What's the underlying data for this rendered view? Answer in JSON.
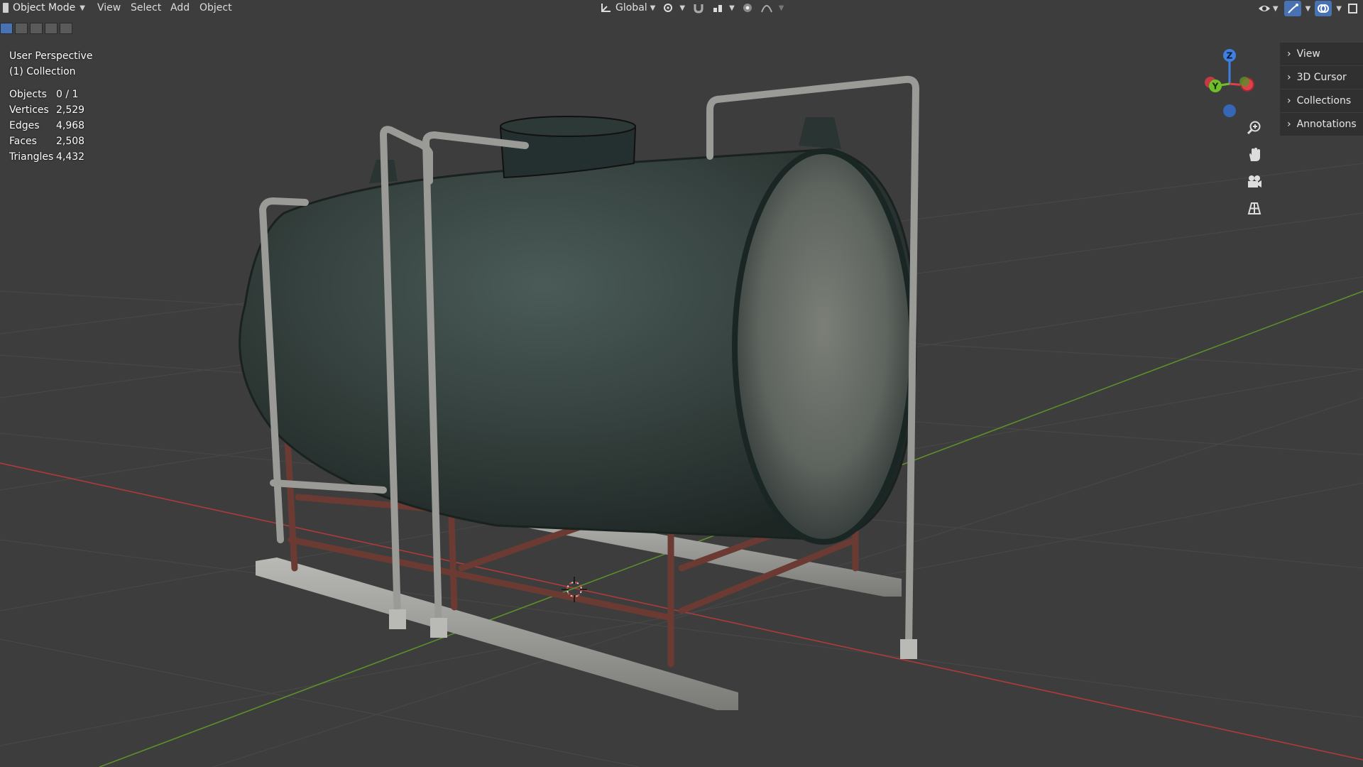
{
  "header": {
    "mode": "Object Mode",
    "menus": [
      "View",
      "Select",
      "Add",
      "Object"
    ],
    "transform_orientation": "Global"
  },
  "overlay": {
    "view_name": "User Perspective",
    "collection": "(1) Collection"
  },
  "stats": [
    {
      "label": "Objects",
      "value": "0 / 1"
    },
    {
      "label": "Vertices",
      "value": "2,529"
    },
    {
      "label": "Edges",
      "value": "4,968"
    },
    {
      "label": "Faces",
      "value": "2,508"
    },
    {
      "label": "Triangles",
      "value": "4,432"
    }
  ],
  "npanel": {
    "tabs": [
      "View",
      "3D Cursor",
      "Collections",
      "Annotations"
    ]
  },
  "gizmo": {
    "z_label": "Z",
    "y_label": "Y",
    "x_color": "#e0404a",
    "y_color": "#6fbf2a",
    "z_color": "#3f7fe0"
  },
  "icons": {
    "zoom": "zoom-icon",
    "pan": "hand-icon",
    "camera": "camera-icon",
    "grid": "grid-icon"
  }
}
